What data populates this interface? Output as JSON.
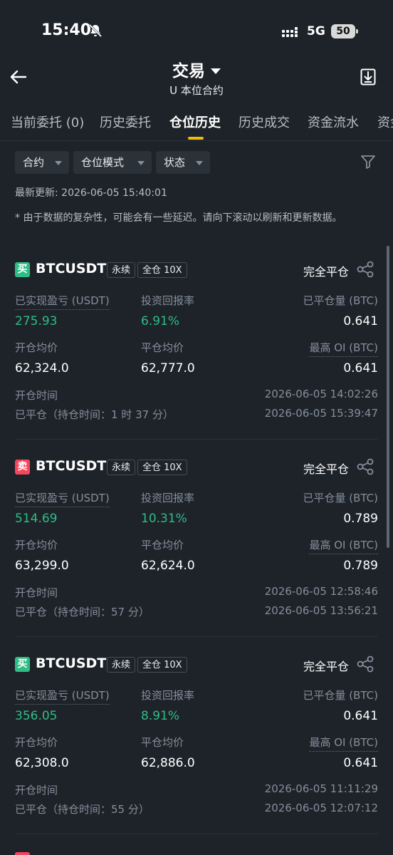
{
  "status_bar": {
    "time": "15:40",
    "network": "5G",
    "battery": "50"
  },
  "header": {
    "title": "交易",
    "subtitle": "U 本位合约"
  },
  "tabs": [
    "当前委托 (0)",
    "历史委托",
    "仓位历史",
    "历史成交",
    "资金流水",
    "资金"
  ],
  "active_tab": "仓位历史",
  "filters": [
    "合约",
    "仓位模式",
    "状态"
  ],
  "last_updated": "最新更新: 2026-06-05 15:40:01",
  "note": "* 由于数据的复杂性，可能会有一些延迟。请向下滚动以刷新和更新数据。",
  "labels": {
    "realized_pnl": "已实现盈亏 (USDT)",
    "roi": "投资回报率",
    "closed_qty": "已平仓量 (BTC)",
    "avg_open": "开仓均价",
    "avg_close": "平仓均价",
    "max_oi": "最高 OI (BTC)",
    "open_time": "开仓时间",
    "closed_status": "完全平仓"
  },
  "colors": {
    "buy": "#2ebd85",
    "sell": "#f6465d",
    "accent": "#f0b90b"
  },
  "positions": [
    {
      "side": "买",
      "symbol": "BTCUSDT",
      "type": "永续",
      "margin": "全仓 10X",
      "pnl": "275.93",
      "roi": "6.91%",
      "closed_qty": "0.641",
      "avg_open": "62,324.0",
      "avg_close": "62,777.0",
      "max_oi": "0.641",
      "open_time": "2026-06-05 14:02:26",
      "closed_label": "已平仓（持仓时间：1 时 37 分）",
      "closed_time": "2026-06-05 15:39:47"
    },
    {
      "side": "卖",
      "symbol": "BTCUSDT",
      "type": "永续",
      "margin": "全仓 10X",
      "pnl": "514.69",
      "roi": "10.31%",
      "closed_qty": "0.789",
      "avg_open": "63,299.0",
      "avg_close": "62,624.0",
      "max_oi": "0.789",
      "open_time": "2026-06-05 12:58:46",
      "closed_label": "已平仓（持仓时间：57 分）",
      "closed_time": "2026-06-05 13:56:21"
    },
    {
      "side": "买",
      "symbol": "BTCUSDT",
      "type": "永续",
      "margin": "全仓 10X",
      "pnl": "356.05",
      "roi": "8.91%",
      "closed_qty": "0.641",
      "avg_open": "62,308.0",
      "avg_close": "62,886.0",
      "max_oi": "0.641",
      "open_time": "2026-06-05 11:11:29",
      "closed_label": "已平仓（持仓时间：55 分）",
      "closed_time": "2026-06-05 12:07:12"
    }
  ]
}
